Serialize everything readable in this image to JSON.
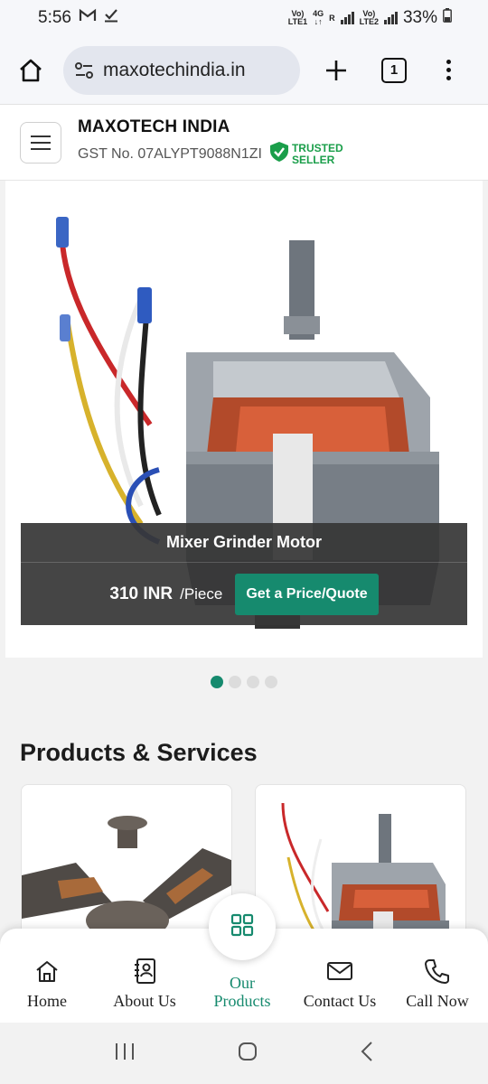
{
  "status_bar": {
    "time": "5:56",
    "net1_top": "Vo)",
    "net1_bottom": "LTE1",
    "net2_top": "4G",
    "net2_bottom": "↓↑",
    "net3_top": "R",
    "net4_top": "Vo)",
    "net4_bottom": "LTE2",
    "battery": "33%"
  },
  "browser": {
    "url": "maxotechindia.in",
    "tab_count": "1"
  },
  "site_header": {
    "company_name": "MAXOTECH INDIA",
    "gst": "GST No. 07ALYPT9088N1ZI",
    "trusted_line1": "TRUSTED",
    "trusted_line2": "SELLER"
  },
  "hero": {
    "product_name": "Mixer Grinder Motor",
    "price": "310 INR",
    "unit": "/Piece",
    "cta": "Get a Price/Quote",
    "slide_count": 4,
    "active_slide": 1
  },
  "products_section": {
    "title": "Products & Services"
  },
  "bottom_nav": {
    "home": "Home",
    "about": "About Us",
    "products_line1": "Our",
    "products_line2": "Products",
    "contact": "Contact Us",
    "call": "Call Now"
  },
  "colors": {
    "accent": "#168a6e",
    "trusted_green": "#1a9e4a"
  }
}
